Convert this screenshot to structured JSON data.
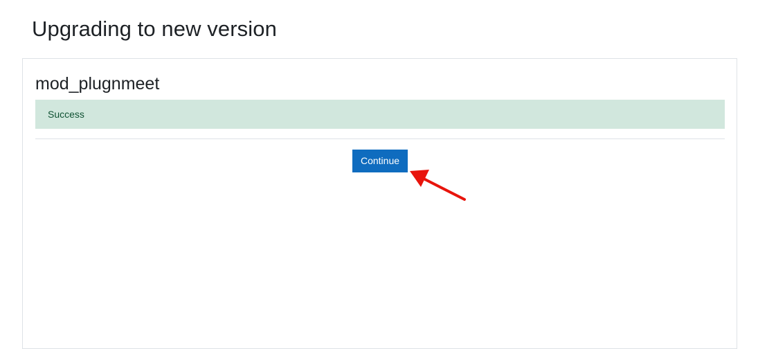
{
  "page": {
    "title": "Upgrading to new version"
  },
  "plugin": {
    "name": "mod_plugnmeet",
    "status_message": "Success"
  },
  "actions": {
    "continue_label": "Continue"
  },
  "colors": {
    "accent": "#0f6cbf",
    "success_bg": "#d1e7dd",
    "success_text": "#0f5132",
    "annotation_arrow": "#e8140c"
  },
  "annotation": {
    "icon": "red-arrow-icon"
  }
}
